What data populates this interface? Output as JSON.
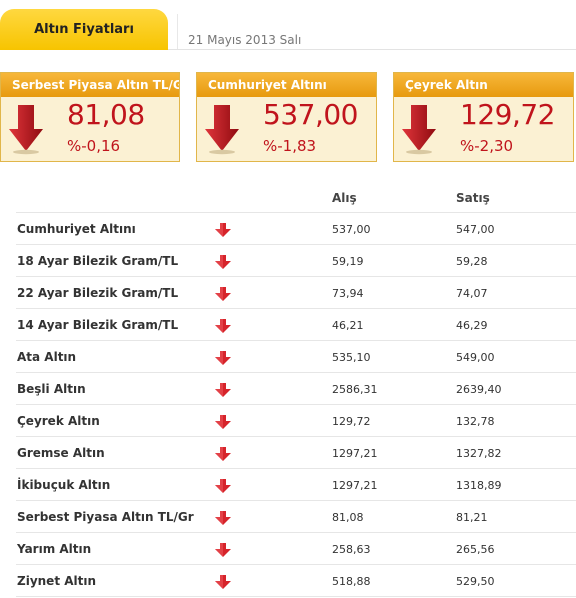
{
  "header": {
    "active_tab": "Altın Fiyatları",
    "date": "21 Mayıs 2013 Salı"
  },
  "summary": [
    {
      "title": "Serbest Piyasa Altın TL/Gr",
      "value": "81,08",
      "change": "%-0,16",
      "trend_icon": "down-arrow-icon"
    },
    {
      "title": "Cumhuriyet Altını",
      "value": "537,00",
      "change": "%-1,83",
      "trend_icon": "down-arrow-icon"
    },
    {
      "title": "Çeyrek Altın",
      "value": "129,72",
      "change": "%-2,30",
      "trend_icon": "down-arrow-icon"
    }
  ],
  "table": {
    "headers": {
      "buy": "Alış",
      "sell": "Satış"
    },
    "rows": [
      {
        "name": "Cumhuriyet Altını",
        "buy": "537,00",
        "sell": "547,00",
        "trend": "down"
      },
      {
        "name": "18 Ayar Bilezik Gram/TL",
        "buy": "59,19",
        "sell": "59,28",
        "trend": "down"
      },
      {
        "name": "22 Ayar Bilezik Gram/TL",
        "buy": "73,94",
        "sell": "74,07",
        "trend": "down"
      },
      {
        "name": "14 Ayar Bilezik Gram/TL",
        "buy": "46,21",
        "sell": "46,29",
        "trend": "down"
      },
      {
        "name": "Ata Altın",
        "buy": "535,10",
        "sell": "549,00",
        "trend": "down"
      },
      {
        "name": "Beşli Altın",
        "buy": "2586,31",
        "sell": "2639,40",
        "trend": "down"
      },
      {
        "name": "Çeyrek Altın",
        "buy": "129,72",
        "sell": "132,78",
        "trend": "down"
      },
      {
        "name": "Gremse Altın",
        "buy": "1297,21",
        "sell": "1327,82",
        "trend": "down"
      },
      {
        "name": "İkibuçuk Altın",
        "buy": "1297,21",
        "sell": "1318,89",
        "trend": "down"
      },
      {
        "name": "Serbest Piyasa Altın TL/Gr",
        "buy": "81,08",
        "sell": "81,21",
        "trend": "down"
      },
      {
        "name": "Yarım Altın",
        "buy": "258,63",
        "sell": "265,56",
        "trend": "down"
      },
      {
        "name": "Ziynet Altın",
        "buy": "518,88",
        "sell": "529,50",
        "trend": "down"
      }
    ]
  },
  "colors": {
    "tab_yellow": "#f7c400",
    "box_header": "#e79a0e",
    "box_bg": "#fbf1d3",
    "down_red": "#c0141c"
  }
}
